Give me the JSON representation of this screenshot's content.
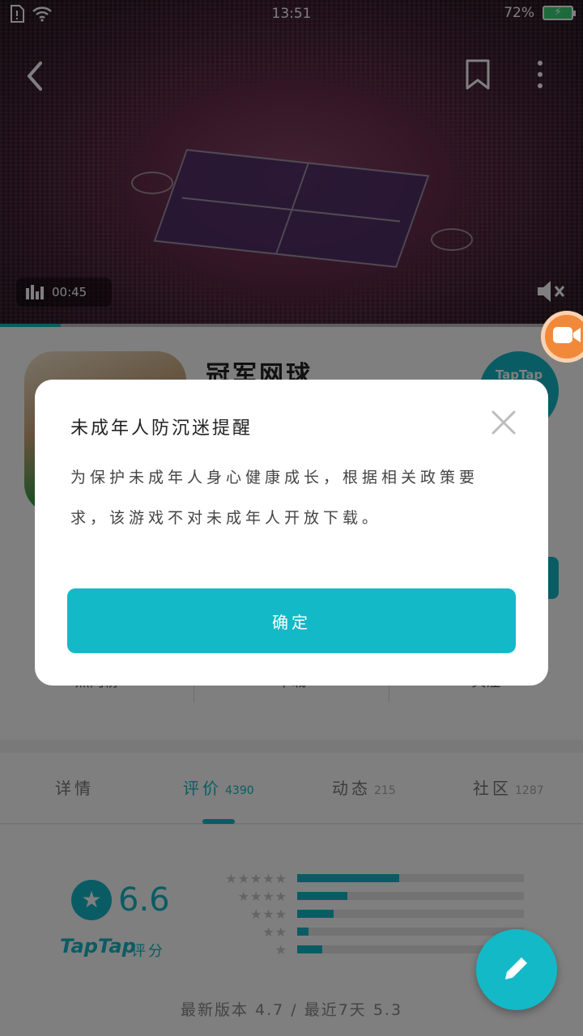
{
  "status_bar": {
    "time": "13:51",
    "battery": "72%"
  },
  "video": {
    "duration": "00:45",
    "progress_fraction": 0.104
  },
  "app": {
    "title": "冠军网球",
    "badge": "TapTap",
    "stats": [
      "热门榜",
      "下载",
      "关注"
    ]
  },
  "dialog": {
    "title": "未成年人防沉迷提醒",
    "message": "为保护未成年人身心健康成长，根据相关政策要求，该游戏不对未成年人开放下载。",
    "confirm_label": "确定"
  },
  "tabs": [
    {
      "label": "详情",
      "count": ""
    },
    {
      "label": "评价",
      "count": "4390"
    },
    {
      "label": "动态",
      "count": "215"
    },
    {
      "label": "社区",
      "count": "1287"
    }
  ],
  "active_tab": 1,
  "rating": {
    "score": "6.6",
    "brand": "TapTap",
    "brand_suffix": "评分",
    "distribution": [
      {
        "stars": "★★★★★",
        "fraction": 0.45
      },
      {
        "stars": "★★★★",
        "fraction": 0.22
      },
      {
        "stars": "★★★",
        "fraction": 0.16
      },
      {
        "stars": "★★",
        "fraction": 0.05
      },
      {
        "stars": "★",
        "fraction": 0.11
      }
    ],
    "version_text": "最新版本 4.7 / 最近7天 5.3"
  },
  "colors": {
    "accent": "#14b9c8",
    "fab_orange": "#f08a3a"
  },
  "icons": [
    "sim-icon",
    "wifi-icon",
    "battery-icon",
    "back-arrow-icon",
    "bookmark-icon",
    "more-dots-icon",
    "signal-bars-icon",
    "mute-icon",
    "video-camera-icon",
    "close-icon",
    "star-icon",
    "pencil-icon"
  ]
}
